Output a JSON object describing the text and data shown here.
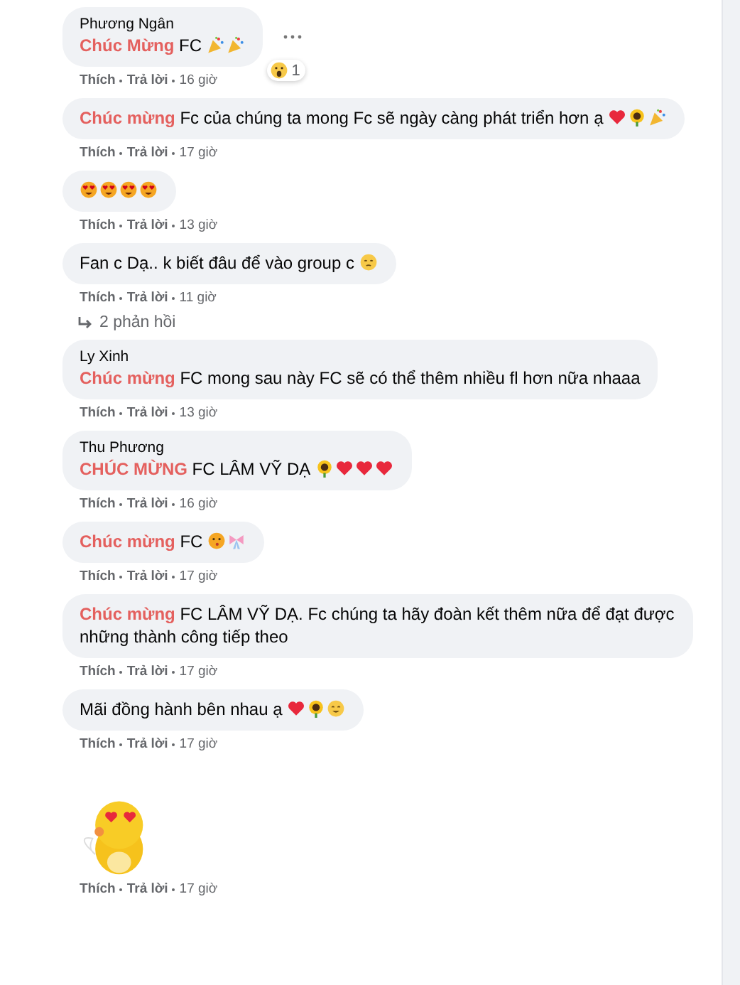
{
  "comments": [
    {
      "name": "Phương Ngân",
      "highlight": "Chúc Mừng",
      "text": "FC",
      "emojis": [
        {
          "kind": "party"
        },
        {
          "kind": "party"
        }
      ],
      "more_menu": true,
      "reaction": {
        "kind": "wow",
        "count": "1"
      },
      "like": "Thích",
      "reply": "Trả lời",
      "time": "16 giờ"
    },
    {
      "highlight": "Chúc mừng",
      "text": "Fc của chúng ta mong Fc sẽ ngày càng phát triển hơn ạ",
      "emojis": [
        {
          "kind": "heart"
        },
        {
          "kind": "sunflower"
        },
        {
          "kind": "party"
        }
      ],
      "like": "Thích",
      "reply": "Trả lời",
      "time": "17 giờ"
    },
    {
      "emojis": [
        {
          "kind": "love-face"
        },
        {
          "kind": "love-face"
        },
        {
          "kind": "love-face"
        },
        {
          "kind": "love-face"
        }
      ],
      "like": "Thích",
      "reply": "Trả lời",
      "time": "13 giờ"
    },
    {
      "text": "Fan c Dạ.. k biết đâu để vào group c",
      "emojis": [
        {
          "kind": "sad"
        }
      ],
      "like": "Thích",
      "reply": "Trả lời",
      "time": "11 giờ",
      "replies": "2 phản hồi"
    },
    {
      "name": "Ly Xinh",
      "highlight": "Chúc mừng",
      "text": "FC mong sau này FC sẽ có thể thêm nhiều fl hơn nữa nhaaa",
      "like": "Thích",
      "reply": "Trả lời",
      "time": "13 giờ"
    },
    {
      "name": "Thu Phương",
      "highlight": "CHÚC MỪNG",
      "text": "FC LÂM VỸ DẠ",
      "emojis": [
        {
          "kind": "sunflower"
        },
        {
          "kind": "heart"
        },
        {
          "kind": "heart"
        },
        {
          "kind": "heart"
        }
      ],
      "like": "Thích",
      "reply": "Trả lời",
      "time": "16 giờ"
    },
    {
      "highlight": "Chúc mừng",
      "text": "FC",
      "emojis": [
        {
          "kind": "kiss"
        },
        {
          "kind": "ribbon"
        }
      ],
      "like": "Thích",
      "reply": "Trả lời",
      "time": "17 giờ"
    },
    {
      "highlight": "Chúc mừng",
      "text": "FC LÂM VỸ DẠ. Fc chúng ta hãy đoàn kết thêm nữa để đạt được những thành công tiếp theo",
      "like": "Thích",
      "reply": "Trả lời",
      "time": "17 giờ"
    },
    {
      "text": "Mãi đồng hành bên nhau ạ",
      "emojis": [
        {
          "kind": "heart"
        },
        {
          "kind": "sunflower"
        },
        {
          "kind": "smile"
        }
      ],
      "like": "Thích",
      "reply": "Trả lời",
      "time": "17 giờ"
    },
    {
      "sticker": true,
      "like": "Thích",
      "reply": "Trả lời",
      "time": "17 giờ"
    }
  ]
}
